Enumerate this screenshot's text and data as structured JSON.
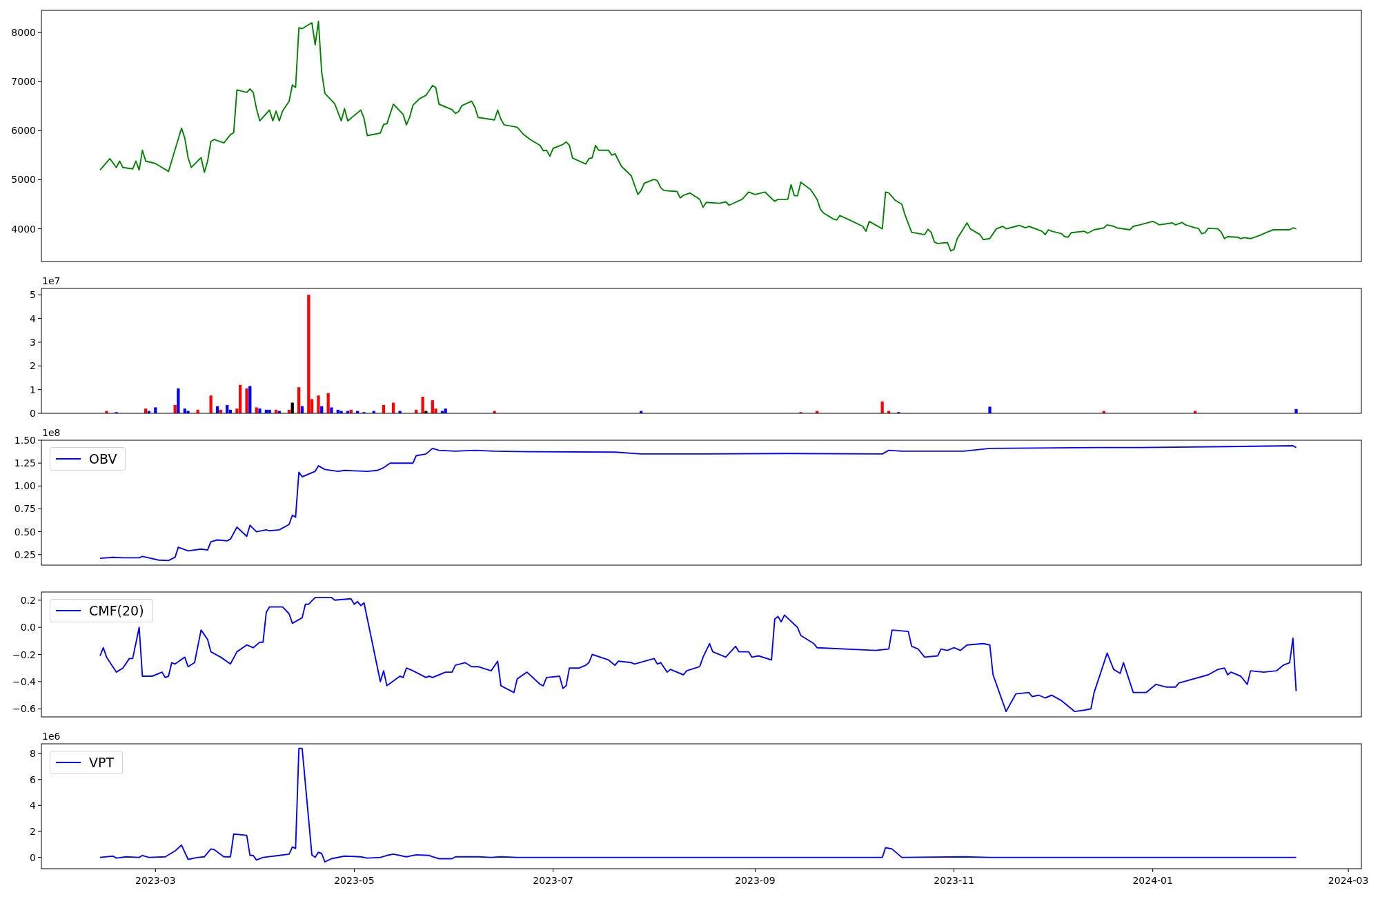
{
  "figure": {
    "panels": [
      {
        "chart_data": {
          "type": "line",
          "xlim": [
            "2023-01-25",
            "2024-03-05"
          ],
          "ylim": [
            3333,
            8453
          ],
          "yticks": [
            4000,
            5000,
            6000,
            7000,
            8000
          ],
          "x": [
            "2023-02-12",
            "2023-02-15",
            "2023-02-17",
            "2023-02-18",
            "2023-02-19",
            "2023-02-22",
            "2023-02-23",
            "2023-02-24",
            "2023-02-25",
            "2023-02-26",
            "2023-03-01",
            "2023-03-05",
            "2023-03-09",
            "2023-03-10",
            "2023-03-11",
            "2023-03-12",
            "2023-03-15",
            "2023-03-16",
            "2023-03-17",
            "2023-03-18",
            "2023-03-19",
            "2023-03-22",
            "2023-03-24",
            "2023-03-25",
            "2023-03-26",
            "2023-03-29",
            "2023-03-30",
            "2023-03-31",
            "2023-04-01",
            "2023-04-02",
            "2023-04-05",
            "2023-04-06",
            "2023-04-07",
            "2023-04-08",
            "2023-04-09",
            "2023-04-11",
            "2023-04-12",
            "2023-04-13",
            "2023-04-14",
            "2023-04-15",
            "2023-04-18",
            "2023-04-19",
            "2023-04-20",
            "2023-04-21",
            "2023-04-22",
            "2023-04-25",
            "2023-04-27",
            "2023-04-28",
            "2023-04-29",
            "2023-05-03",
            "2023-05-04",
            "2023-05-05",
            "2023-05-09",
            "2023-05-10",
            "2023-05-11",
            "2023-05-13",
            "2023-05-16",
            "2023-05-17",
            "2023-05-18",
            "2023-05-19",
            "2023-05-21",
            "2023-05-23",
            "2023-05-25",
            "2023-05-26",
            "2023-05-27",
            "2023-05-31",
            "2023-06-01",
            "2023-06-02",
            "2023-06-03",
            "2023-06-06",
            "2023-06-07",
            "2023-06-08",
            "2023-06-13",
            "2023-06-14",
            "2023-06-15",
            "2023-06-16",
            "2023-06-20",
            "2023-06-22",
            "2023-06-24",
            "2023-06-27",
            "2023-06-28",
            "2023-06-29",
            "2023-06-30",
            "2023-07-01",
            "2023-07-04",
            "2023-07-05",
            "2023-07-06",
            "2023-07-07",
            "2023-07-11",
            "2023-07-12",
            "2023-07-13",
            "2023-07-14",
            "2023-07-15",
            "2023-07-18",
            "2023-07-19",
            "2023-07-20",
            "2023-07-22",
            "2023-07-25",
            "2023-07-27",
            "2023-07-28",
            "2023-07-29",
            "2023-08-01",
            "2023-08-02",
            "2023-08-03",
            "2023-08-04",
            "2023-08-08",
            "2023-08-09",
            "2023-08-10",
            "2023-08-12",
            "2023-08-15",
            "2023-08-16",
            "2023-08-17",
            "2023-08-21",
            "2023-08-23",
            "2023-08-24",
            "2023-08-28",
            "2023-08-30",
            "2023-09-01",
            "2023-09-04",
            "2023-09-06",
            "2023-09-07",
            "2023-09-08",
            "2023-09-11",
            "2023-09-12",
            "2023-09-13",
            "2023-09-14",
            "2023-09-15",
            "2023-09-18",
            "2023-09-19",
            "2023-09-20",
            "2023-09-21",
            "2023-09-22",
            "2023-09-25",
            "2023-09-26",
            "2023-09-27",
            "2023-09-30",
            "2023-10-04",
            "2023-10-05",
            "2023-10-06",
            "2023-10-10",
            "2023-10-11",
            "2023-10-12",
            "2023-10-14",
            "2023-10-16",
            "2023-10-17",
            "2023-10-19",
            "2023-10-23",
            "2023-10-24",
            "2023-10-25",
            "2023-10-26",
            "2023-10-27",
            "2023-10-30",
            "2023-10-31",
            "2023-11-01",
            "2023-11-02",
            "2023-11-05",
            "2023-11-06",
            "2023-11-09",
            "2023-11-10",
            "2023-11-12",
            "2023-11-14",
            "2023-11-16",
            "2023-11-17",
            "2023-11-20",
            "2023-11-21",
            "2023-11-23",
            "2023-11-24",
            "2023-11-28",
            "2023-11-29",
            "2023-11-30",
            "2023-12-01",
            "2023-12-04",
            "2023-12-05",
            "2023-12-06",
            "2023-12-07",
            "2023-12-11",
            "2023-12-12",
            "2023-12-14",
            "2023-12-17",
            "2023-12-18",
            "2023-12-20",
            "2023-12-21",
            "2023-12-25",
            "2023-12-26",
            "2023-12-28",
            "2024-01-01",
            "2024-01-02",
            "2024-01-03",
            "2024-01-07",
            "2024-01-08",
            "2024-01-10",
            "2024-01-11",
            "2024-01-14",
            "2024-01-15",
            "2024-01-16",
            "2024-01-17",
            "2024-01-18",
            "2024-01-21",
            "2024-01-22",
            "2024-01-23",
            "2024-01-24",
            "2024-01-27",
            "2024-01-28",
            "2024-01-29",
            "2024-01-31",
            "2024-02-03",
            "2024-02-05",
            "2024-02-07",
            "2024-02-12",
            "2024-02-13",
            "2024-02-14"
          ],
          "series": [
            {
              "color": "#008000",
              "values": [
                5200,
                5430,
                5250,
                5380,
                5250,
                5220,
                5380,
                5200,
                5600,
                5380,
                5330,
                5170,
                6050,
                5850,
                5450,
                5250,
                5450,
                5150,
                5380,
                5780,
                5820,
                5750,
                5920,
                5960,
                6830,
                6780,
                6850,
                6780,
                6450,
                6200,
                6420,
                6200,
                6400,
                6200,
                6400,
                6600,
                6930,
                6880,
                8100,
                8080,
                8200,
                7750,
                8230,
                7200,
                6760,
                6550,
                6200,
                6450,
                6200,
                6420,
                6250,
                5900,
                5950,
                6130,
                6140,
                6540,
                6330,
                6120,
                6280,
                6520,
                6650,
                6720,
                6920,
                6880,
                6540,
                6430,
                6350,
                6390,
                6510,
                6600,
                6480,
                6270,
                6220,
                6420,
                6230,
                6120,
                6070,
                5920,
                5820,
                5700,
                5590,
                5600,
                5480,
                5640,
                5720,
                5770,
                5700,
                5440,
                5320,
                5430,
                5450,
                5700,
                5600,
                5600,
                5500,
                5530,
                5270,
                5080,
                4700,
                4780,
                4930,
                5010,
                4980,
                4840,
                4780,
                4760,
                4630,
                4680,
                4730,
                4600,
                4440,
                4540,
                4520,
                4550,
                4480,
                4600,
                4750,
                4700,
                4750,
                4620,
                4560,
                4600,
                4600,
                4900,
                4680,
                4670,
                4950,
                4800,
                4700,
                4600,
                4400,
                4320,
                4200,
                4180,
                4270,
                4180,
                4050,
                3950,
                4150,
                4000,
                4750,
                4730,
                4580,
                4500,
                4280,
                3930,
                3880,
                3990,
                3930,
                3730,
                3700,
                3720,
                3550,
                3580,
                3800,
                4120,
                4000,
                3880,
                3780,
                3800,
                4000,
                4050,
                4000,
                4050,
                4070,
                4020,
                4050,
                3950,
                3880,
                3980,
                3950,
                3900,
                3840,
                3830,
                3920,
                3950,
                3910,
                3980,
                4020,
                4080,
                4050,
                4020,
                3980,
                4050,
                4080,
                4150,
                4120,
                4080,
                4120,
                4080,
                4130,
                4080,
                4020,
                4010,
                3900,
                3920,
                4010,
                4000,
                3930,
                3800,
                3840,
                3830,
                3800,
                3820,
                3800,
                3870,
                3930,
                3980,
                3980,
                4020,
                4000
              ]
            }
          ]
        }
      },
      {
        "offset_label": "1e7",
        "chart_data": {
          "type": "bar",
          "xlim": [
            "2023-01-25",
            "2024-03-05"
          ],
          "ylim": [
            0,
            5.27
          ],
          "yticks": [
            0,
            1,
            2,
            3,
            4,
            5
          ],
          "x": [
            "2023-02-14",
            "2023-02-17",
            "2023-02-26",
            "2023-02-27",
            "2023-03-01",
            "2023-03-07",
            "2023-03-08",
            "2023-03-10",
            "2023-03-11",
            "2023-03-14",
            "2023-03-18",
            "2023-03-20",
            "2023-03-21",
            "2023-03-23",
            "2023-03-24",
            "2023-03-26",
            "2023-03-27",
            "2023-03-29",
            "2023-03-30",
            "2023-04-01",
            "2023-04-02",
            "2023-04-04",
            "2023-04-05",
            "2023-04-07",
            "2023-04-08",
            "2023-04-11",
            "2023-04-12",
            "2023-04-14",
            "2023-04-15",
            "2023-04-17",
            "2023-04-18",
            "2023-04-20",
            "2023-04-21",
            "2023-04-23",
            "2023-04-24",
            "2023-04-26",
            "2023-04-27",
            "2023-04-29",
            "2023-04-30",
            "2023-05-02",
            "2023-05-04",
            "2023-05-07",
            "2023-05-10",
            "2023-05-13",
            "2023-05-15",
            "2023-05-20",
            "2023-05-22",
            "2023-05-23",
            "2023-05-25",
            "2023-05-26",
            "2023-05-28",
            "2023-05-29",
            "2023-06-13",
            "2023-07-28",
            "2023-09-15",
            "2023-09-20",
            "2023-10-10",
            "2023-10-12",
            "2023-10-15",
            "2023-11-12",
            "2023-12-17",
            "2024-01-14",
            "2024-02-14"
          ],
          "series": [
            {
              "color": "#ff0000",
              "values": [
                0.1,
                null,
                0.2,
                null,
                null,
                0.35,
                null,
                null,
                null,
                0.15,
                0.75,
                null,
                0.15,
                null,
                null,
                0.2,
                1.2,
                1.05,
                null,
                0.25,
                null,
                null,
                null,
                0.15,
                null,
                0.15,
                null,
                1.1,
                null,
                5.0,
                0.6,
                0.75,
                null,
                0.85,
                null,
                null,
                null,
                null,
                0.15,
                null,
                null,
                null,
                0.35,
                0.45,
                null,
                0.15,
                0.7,
                null,
                0.55,
                0.2,
                null,
                null,
                0.1,
                null,
                0.05,
                0.1,
                0.5,
                0.1,
                null,
                null,
                0.1,
                0.1,
                null
              ]
            },
            {
              "color": "#0000ff",
              "values": [
                null,
                0.05,
                null,
                0.1,
                0.25,
                null,
                1.05,
                0.2,
                0.1,
                null,
                null,
                0.3,
                null,
                0.35,
                0.15,
                null,
                null,
                null,
                1.15,
                null,
                0.2,
                0.15,
                0.15,
                null,
                0.1,
                null,
                null,
                null,
                0.3,
                null,
                null,
                null,
                0.3,
                null,
                0.25,
                0.15,
                0.1,
                0.1,
                null,
                0.1,
                0.05,
                0.1,
                null,
                null,
                0.1,
                null,
                null,
                null,
                null,
                null,
                0.1,
                0.2,
                null,
                0.1,
                null,
                null,
                null,
                null,
                0.05,
                0.28,
                null,
                null,
                0.18
              ]
            },
            {
              "color": "#000000",
              "values": [
                null,
                null,
                null,
                null,
                null,
                null,
                null,
                null,
                null,
                null,
                null,
                null,
                null,
                null,
                null,
                null,
                null,
                null,
                null,
                null,
                null,
                null,
                null,
                null,
                null,
                null,
                0.45,
                null,
                null,
                null,
                null,
                null,
                null,
                null,
                null,
                null,
                null,
                null,
                null,
                null,
                null,
                null,
                null,
                null,
                null,
                null,
                null,
                0.1,
                null,
                null,
                null,
                null,
                null,
                null,
                null,
                null,
                null,
                null,
                null,
                null,
                null,
                null,
                null
              ]
            }
          ]
        }
      },
      {
        "offset_label": "1e8",
        "chart_data": {
          "type": "line",
          "xlim": [
            "2023-01-25",
            "2024-03-05"
          ],
          "ylim": [
            0.135,
            1.5
          ],
          "yticks": [
            {
              "value": 0.25,
              "label": "0.25"
            },
            {
              "value": 0.5,
              "label": "0.50"
            },
            {
              "value": 0.75,
              "label": "0.75"
            },
            {
              "value": 1,
              "label": "1.00"
            },
            {
              "value": 1.25,
              "label": "1.25"
            },
            {
              "value": 1.5,
              "label": "1.50"
            }
          ],
          "x": [
            "2023-02-12",
            "2023-02-16",
            "2023-02-19",
            "2023-02-24",
            "2023-02-25",
            "2023-03-02",
            "2023-03-05",
            "2023-03-07",
            "2023-03-08",
            "2023-03-11",
            "2023-03-15",
            "2023-03-17",
            "2023-03-18",
            "2023-03-20",
            "2023-03-23",
            "2023-03-24",
            "2023-03-26",
            "2023-03-29",
            "2023-03-30",
            "2023-04-01",
            "2023-04-04",
            "2023-04-05",
            "2023-04-08",
            "2023-04-11",
            "2023-04-12",
            "2023-04-13",
            "2023-04-14",
            "2023-04-15",
            "2023-04-19",
            "2023-04-20",
            "2023-04-22",
            "2023-04-26",
            "2023-04-28",
            "2023-05-05",
            "2023-05-08",
            "2023-05-10",
            "2023-05-12",
            "2023-05-19",
            "2023-05-20",
            "2023-05-23",
            "2023-05-25",
            "2023-05-27",
            "2023-06-01",
            "2023-06-07",
            "2023-06-13",
            "2023-06-23",
            "2023-07-20",
            "2023-07-28",
            "2023-08-16",
            "2023-09-11",
            "2023-10-10",
            "2023-10-12",
            "2023-10-16",
            "2023-11-04",
            "2023-11-12",
            "2023-12-15",
            "2023-12-28",
            "2024-01-24",
            "2024-02-13",
            "2024-02-14"
          ],
          "series": [
            {
              "name": "OBV",
              "color": "#0000ff",
              "values": [
                0.21,
                0.22,
                0.215,
                0.215,
                0.23,
                0.19,
                0.185,
                0.22,
                0.33,
                0.29,
                0.31,
                0.3,
                0.39,
                0.41,
                0.4,
                0.42,
                0.55,
                0.45,
                0.57,
                0.5,
                0.52,
                0.51,
                0.52,
                0.58,
                0.68,
                0.66,
                1.15,
                1.1,
                1.16,
                1.22,
                1.18,
                1.16,
                1.17,
                1.16,
                1.17,
                1.2,
                1.25,
                1.25,
                1.33,
                1.35,
                1.41,
                1.39,
                1.38,
                1.39,
                1.38,
                1.375,
                1.37,
                1.35,
                1.35,
                1.355,
                1.35,
                1.39,
                1.38,
                1.38,
                1.41,
                1.42,
                1.42,
                1.43,
                1.44,
                1.42
              ]
            }
          ]
        }
      },
      {
        "chart_data": {
          "type": "line",
          "xlim": [
            "2023-01-25",
            "2024-03-05"
          ],
          "ylim": [
            -0.66,
            0.26
          ],
          "yticks": [
            {
              "value": -0.6,
              "label": "−0.6"
            },
            {
              "value": -0.4,
              "label": "−0.4"
            },
            {
              "value": -0.2,
              "label": "−0.2"
            },
            {
              "value": 0,
              "label": "0.0"
            },
            {
              "value": 0.2,
              "label": "0.2"
            }
          ],
          "x": [
            "2023-02-12",
            "2023-02-13",
            "2023-02-14",
            "2023-02-17",
            "2023-02-19",
            "2023-02-21",
            "2023-02-22",
            "2023-02-24",
            "2023-02-25",
            "2023-02-28",
            "2023-03-03",
            "2023-03-04",
            "2023-03-05",
            "2023-03-06",
            "2023-03-07",
            "2023-03-10",
            "2023-03-11",
            "2023-03-13",
            "2023-03-15",
            "2023-03-17",
            "2023-03-18",
            "2023-03-21",
            "2023-03-24",
            "2023-03-26",
            "2023-03-29",
            "2023-03-31",
            "2023-04-02",
            "2023-04-03",
            "2023-04-04",
            "2023-04-05",
            "2023-04-09",
            "2023-04-11",
            "2023-04-12",
            "2023-04-15",
            "2023-04-16",
            "2023-04-17",
            "2023-04-19",
            "2023-04-24",
            "2023-04-25",
            "2023-04-30",
            "2023-05-01",
            "2023-05-02",
            "2023-05-03",
            "2023-05-04",
            "2023-05-09",
            "2023-05-10",
            "2023-05-11",
            "2023-05-15",
            "2023-05-16",
            "2023-05-17",
            "2023-05-19",
            "2023-05-23",
            "2023-05-24",
            "2023-05-25",
            "2023-05-27",
            "2023-05-29",
            "2023-05-31",
            "2023-06-01",
            "2023-06-04",
            "2023-06-06",
            "2023-06-08",
            "2023-06-12",
            "2023-06-14",
            "2023-06-15",
            "2023-06-19",
            "2023-06-20",
            "2023-06-23",
            "2023-06-27",
            "2023-06-28",
            "2023-06-29",
            "2023-07-03",
            "2023-07-04",
            "2023-07-05",
            "2023-07-06",
            "2023-07-09",
            "2023-07-11",
            "2023-07-12",
            "2023-07-13",
            "2023-07-18",
            "2023-07-20",
            "2023-07-21",
            "2023-07-25",
            "2023-07-26",
            "2023-08-01",
            "2023-08-02",
            "2023-08-03",
            "2023-08-05",
            "2023-08-06",
            "2023-08-10",
            "2023-08-11",
            "2023-08-15",
            "2023-08-16",
            "2023-08-18",
            "2023-08-19",
            "2023-08-23",
            "2023-08-26",
            "2023-08-27",
            "2023-08-30",
            "2023-08-31",
            "2023-09-02",
            "2023-09-06",
            "2023-09-07",
            "2023-09-08",
            "2023-09-09",
            "2023-09-10",
            "2023-09-14",
            "2023-09-15",
            "2023-09-19",
            "2023-09-20",
            "2023-10-08",
            "2023-10-12",
            "2023-10-13",
            "2023-10-18",
            "2023-10-19",
            "2023-10-21",
            "2023-10-23",
            "2023-10-27",
            "2023-10-28",
            "2023-10-30",
            "2023-11-01",
            "2023-11-03",
            "2023-11-05",
            "2023-11-10",
            "2023-11-12",
            "2023-11-13",
            "2023-11-17",
            "2023-11-20",
            "2023-11-24",
            "2023-11-25",
            "2023-11-27",
            "2023-11-29",
            "2023-12-01",
            "2023-12-04",
            "2023-12-08",
            "2023-12-11",
            "2023-12-13",
            "2023-12-14",
            "2023-12-18",
            "2023-12-20",
            "2023-12-22",
            "2023-12-23",
            "2023-12-26",
            "2023-12-30",
            "2024-01-02",
            "2024-01-05",
            "2024-01-08",
            "2024-01-09",
            "2024-01-18",
            "2024-01-21",
            "2024-01-23",
            "2024-01-24",
            "2024-01-25",
            "2024-01-28",
            "2024-01-30",
            "2024-01-31",
            "2024-02-04",
            "2024-02-08",
            "2024-02-10",
            "2024-02-12",
            "2024-02-13",
            "2024-02-14"
          ],
          "series": [
            {
              "name": "CMF(20)",
              "color": "#0000ff",
              "values": [
                -0.21,
                -0.15,
                -0.22,
                -0.33,
                -0.3,
                -0.23,
                -0.23,
                0,
                -0.36,
                -0.36,
                -0.33,
                -0.37,
                -0.36,
                -0.26,
                -0.27,
                -0.22,
                -0.29,
                -0.26,
                -0.02,
                -0.09,
                -0.18,
                -0.22,
                -0.27,
                -0.18,
                -0.13,
                -0.15,
                -0.11,
                -0.11,
                0.11,
                0.15,
                0.15,
                0.1,
                0.03,
                0.07,
                0.17,
                0.17,
                0.22,
                0.22,
                0.2,
                0.21,
                0.17,
                0.19,
                0.16,
                0.18,
                -0.4,
                -0.32,
                -0.43,
                -0.36,
                -0.37,
                -0.3,
                -0.32,
                -0.37,
                -0.36,
                -0.37,
                -0.35,
                -0.33,
                -0.33,
                -0.28,
                -0.26,
                -0.29,
                -0.29,
                -0.32,
                -0.25,
                -0.43,
                -0.48,
                -0.38,
                -0.33,
                -0.42,
                -0.43,
                -0.37,
                -0.36,
                -0.45,
                -0.43,
                -0.3,
                -0.3,
                -0.28,
                -0.26,
                -0.2,
                -0.24,
                -0.28,
                -0.25,
                -0.26,
                -0.27,
                -0.23,
                -0.27,
                -0.26,
                -0.33,
                -0.31,
                -0.35,
                -0.32,
                -0.29,
                -0.22,
                -0.12,
                -0.18,
                -0.22,
                -0.14,
                -0.18,
                -0.18,
                -0.22,
                -0.21,
                -0.24,
                0.06,
                0.08,
                0.04,
                0.09,
                0,
                -0.06,
                -0.12,
                -0.15,
                -0.17,
                -0.16,
                -0.02,
                -0.03,
                -0.14,
                -0.16,
                -0.22,
                -0.21,
                -0.16,
                -0.17,
                -0.15,
                -0.17,
                -0.13,
                -0.12,
                -0.13,
                -0.35,
                -0.62,
                -0.49,
                -0.48,
                -0.51,
                -0.5,
                -0.52,
                -0.5,
                -0.54,
                -0.62,
                -0.61,
                -0.6,
                -0.48,
                -0.19,
                -0.31,
                -0.34,
                -0.26,
                -0.48,
                -0.48,
                -0.42,
                -0.44,
                -0.44,
                -0.41,
                -0.35,
                -0.31,
                -0.3,
                -0.35,
                -0.33,
                -0.36,
                -0.42,
                -0.32,
                -0.33,
                -0.32,
                -0.28,
                -0.26,
                -0.08,
                -0.47
              ]
            }
          ]
        }
      },
      {
        "offset_label": "1e6",
        "chart_data": {
          "type": "line",
          "xlim": [
            "2023-01-25",
            "2024-03-05"
          ],
          "ylim": [
            -0.87,
            8.75
          ],
          "yticks": [
            0,
            2,
            4,
            6,
            8
          ],
          "xticks": [
            {
              "value": "2023-03-01",
              "label": "2023-03"
            },
            {
              "value": "2023-05-01",
              "label": "2023-05"
            },
            {
              "value": "2023-07-01",
              "label": "2023-07"
            },
            {
              "value": "2023-09-01",
              "label": "2023-09"
            },
            {
              "value": "2023-11-01",
              "label": "2023-11"
            },
            {
              "value": "2024-01-01",
              "label": "2024-01"
            },
            {
              "value": "2024-03-01",
              "label": "2024-03"
            }
          ],
          "x": [
            "2023-02-12",
            "2023-02-16",
            "2023-02-17",
            "2023-02-20",
            "2023-02-24",
            "2023-02-25",
            "2023-02-27",
            "2023-03-04",
            "2023-03-07",
            "2023-03-09",
            "2023-03-11",
            "2023-03-14",
            "2023-03-16",
            "2023-03-18",
            "2023-03-19",
            "2023-03-22",
            "2023-03-24",
            "2023-03-25",
            "2023-03-29",
            "2023-03-30",
            "2023-03-31",
            "2023-04-01",
            "2023-04-03",
            "2023-04-08",
            "2023-04-11",
            "2023-04-12",
            "2023-04-13",
            "2023-04-14",
            "2023-04-15",
            "2023-04-18",
            "2023-04-19",
            "2023-04-20",
            "2023-04-21",
            "2023-04-22",
            "2023-04-24",
            "2023-04-28",
            "2023-05-03",
            "2023-05-05",
            "2023-05-09",
            "2023-05-11",
            "2023-05-13",
            "2023-05-17",
            "2023-05-20",
            "2023-05-24",
            "2023-05-25",
            "2023-05-27",
            "2023-05-31",
            "2023-06-01",
            "2023-06-08",
            "2023-06-12",
            "2023-06-15",
            "2023-06-20",
            "2023-07-20",
            "2023-10-10",
            "2023-10-11",
            "2023-10-13",
            "2023-10-16",
            "2023-11-04",
            "2023-11-12",
            "2024-02-14"
          ],
          "series": [
            {
              "name": "VPT",
              "color": "#0000ff",
              "values": [
                0,
                0.1,
                -0.05,
                0.05,
                0,
                0.15,
                0,
                0.05,
                0.5,
                0.95,
                -0.15,
                0,
                0.05,
                0.65,
                0.6,
                0.05,
                0.05,
                1.8,
                1.7,
                0.15,
                0.15,
                -0.2,
                0,
                0.15,
                0.25,
                0.8,
                0.7,
                8.4,
                8.4,
                0.2,
                0,
                0.4,
                0.3,
                -0.35,
                -0.1,
                0.1,
                0.05,
                -0.05,
                0,
                0.15,
                0.25,
                0.05,
                0.2,
                0.15,
                0.05,
                -0.1,
                -0.1,
                0.05,
                0.05,
                0,
                0.05,
                0,
                0,
                0,
                0.75,
                0.65,
                0,
                0.05,
                0,
                0
              ]
            }
          ]
        }
      }
    ]
  }
}
